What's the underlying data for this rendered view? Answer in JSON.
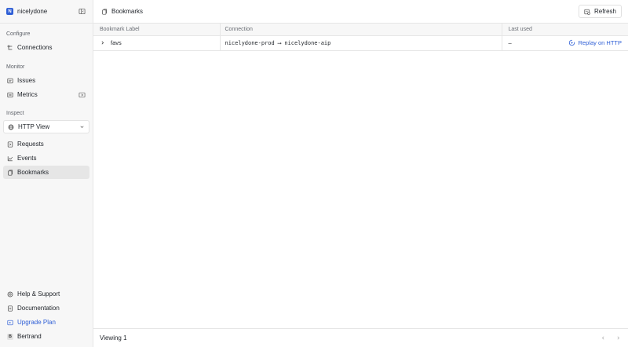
{
  "workspace": {
    "initial": "N",
    "name": "nicelydone"
  },
  "sidebar": {
    "sections": [
      {
        "label": "Configure"
      },
      {
        "label": "Monitor"
      },
      {
        "label": "Inspect"
      }
    ],
    "items": {
      "connections": {
        "label": "Connections",
        "icon": "connections-icon"
      },
      "issues": {
        "label": "Issues",
        "icon": "issues-icon"
      },
      "metrics": {
        "label": "Metrics",
        "icon": "metrics-icon"
      },
      "http_view": {
        "label": "HTTP View",
        "icon": "globe-icon"
      },
      "requests": {
        "label": "Requests",
        "icon": "requests-icon"
      },
      "events": {
        "label": "Events",
        "icon": "events-icon"
      },
      "bookmarks": {
        "label": "Bookmarks",
        "icon": "bookmark-icon"
      }
    },
    "bottom": {
      "help": {
        "label": "Help & Support",
        "icon": "help-icon"
      },
      "docs": {
        "label": "Documentation",
        "icon": "document-icon"
      },
      "upgrade": {
        "label": "Upgrade Plan",
        "icon": "upgrade-icon"
      },
      "user": {
        "initial": "B",
        "name": "Bertrand"
      }
    }
  },
  "header": {
    "title": "Bookmarks",
    "refresh_label": "Refresh"
  },
  "table": {
    "columns": [
      "Bookmark Label",
      "Connection",
      "Last used"
    ],
    "rows": [
      {
        "label": "favs",
        "connection": "nicelydone-prod ⟶ nicelydone-aip",
        "last_used": "–",
        "action": "Replay on HTTP"
      }
    ]
  },
  "footer": {
    "viewing": "Viewing 1"
  },
  "colors": {
    "accent": "#2f5fd6",
    "active_bg": "#e6e6e6",
    "sidebar_bg": "#f7f7f7"
  }
}
